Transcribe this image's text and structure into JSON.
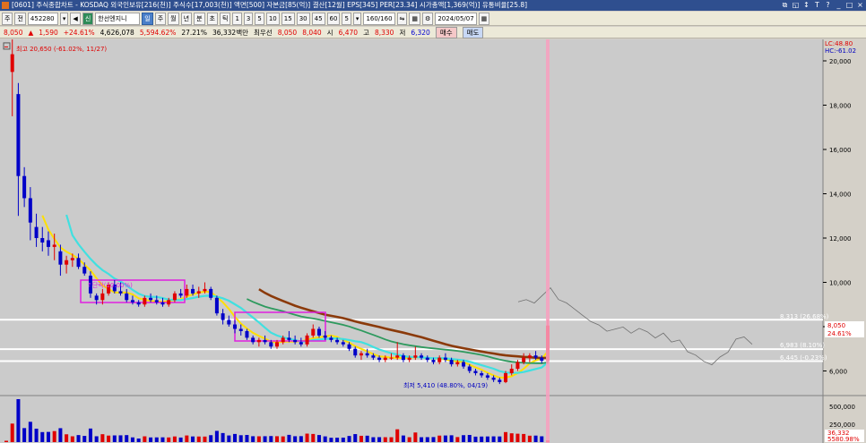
{
  "window": {
    "title": "[0601] 주식종합차트 - KOSDAQ 외국인보유[216(천)] 주식수[17,003(천)] 액면[500] 자본금[85(억)] 결산[12월] EPS[345] PER[23.34] 시가총액[1,369(억)] 유통비율[25.8]",
    "buttons": [
      "⧉",
      "◱",
      "?",
      "↕",
      "T",
      "?",
      "|",
      "_",
      "□",
      "×"
    ]
  },
  "toolbar": {
    "mode": "주",
    "market": "전",
    "code": "452280",
    "stock_name": "한선엔지니",
    "periods": [
      "일",
      "주",
      "월",
      "년",
      "분",
      "초",
      "틱"
    ],
    "active_period": "일",
    "intervals": [
      "1",
      "3",
      "5",
      "10",
      "15",
      "30",
      "45",
      "60"
    ],
    "interval_select": "5",
    "count": "160/160",
    "date": "2024/05/07"
  },
  "quote": {
    "price": "8,050",
    "change_arrow": "▲",
    "change": "1,590",
    "change_pct": "+24.61%",
    "volume": "4,626,078",
    "vol_pct": "5,594.62%",
    "turnover": "27.21%",
    "amount": "36,332백만",
    "priority_label": "최우선",
    "ask": "8,050",
    "bid": "8,040",
    "open_label": "시",
    "open": "6,470",
    "high_label": "고",
    "high": "8,330",
    "low_label": "저",
    "low": "6,320",
    "buy_btn": "매수",
    "sell_btn": "매도"
  },
  "chart_data": {
    "type": "candlestick",
    "price_axis": {
      "ticks": [
        20000,
        18000,
        16000,
        14000,
        12000,
        10000,
        8000,
        6000
      ],
      "tick_labels": [
        "20,000",
        "18,000",
        "16,000",
        "14,000",
        "12,000",
        "10,000",
        "8,000",
        "6,000"
      ],
      "range": [
        4900,
        21500
      ]
    },
    "volume_axis": {
      "tick_labels": [
        "500,000",
        "250,000"
      ]
    },
    "top_right_labels": {
      "lc": "LC:48.80",
      "hc": "HC:-61.02"
    },
    "current_price_label": "8,050",
    "current_change_label": "24.61%",
    "volume_labels": {
      "value": "36,332",
      "pct": "5580.98%"
    },
    "annotations": {
      "high": "최고 20,650 (-61.02%, 11/27)",
      "low": "최저 5,410 (48.80%, 04/19)",
      "box_label": "↑단락(10.00%)"
    },
    "levels": [
      {
        "value": 8313,
        "label": "8,313 (26.68%)"
      },
      {
        "value": 6983,
        "label": "6,983 (8.10%)"
      },
      {
        "value": 6445,
        "label": "6,445 (-0.23%)"
      }
    ],
    "candles": [
      [
        20650,
        20650,
        20650,
        20650
      ],
      [
        19500,
        21000,
        17500,
        20300
      ],
      [
        18500,
        19000,
        13000,
        14800
      ],
      [
        14800,
        15200,
        13400,
        13800
      ],
      [
        13800,
        14300,
        11900,
        12700
      ],
      [
        12500,
        13100,
        11600,
        12000
      ],
      [
        12000,
        12500,
        11400,
        11800
      ],
      [
        11900,
        12300,
        11200,
        11600
      ],
      [
        11600,
        12200,
        11000,
        11700
      ],
      [
        11400,
        11700,
        10300,
        10800
      ],
      [
        10800,
        11200,
        10400,
        11000
      ],
      [
        11000,
        11300,
        10700,
        11100
      ],
      [
        11100,
        11300,
        10600,
        10700
      ],
      [
        10700,
        10900,
        10300,
        10400
      ],
      [
        10300,
        10500,
        9300,
        9500
      ],
      [
        9400,
        9500,
        9000,
        9200
      ],
      [
        9200,
        9700,
        9000,
        9500
      ],
      [
        9500,
        10000,
        9400,
        9900
      ],
      [
        9900,
        10100,
        9500,
        9600
      ],
      [
        9600,
        10000,
        9400,
        9500
      ],
      [
        9500,
        9700,
        9100,
        9200
      ],
      [
        9200,
        9400,
        9000,
        9100
      ],
      [
        9100,
        9200,
        8900,
        9000
      ],
      [
        9000,
        9400,
        8900,
        9300
      ],
      [
        9300,
        9500,
        9100,
        9200
      ],
      [
        9200,
        9400,
        9000,
        9100
      ],
      [
        9100,
        9300,
        8900,
        9000
      ],
      [
        9000,
        9300,
        8900,
        9200
      ],
      [
        9200,
        9600,
        9100,
        9500
      ],
      [
        9500,
        9700,
        9300,
        9400
      ],
      [
        9400,
        9900,
        9300,
        9700
      ],
      [
        9700,
        9900,
        9400,
        9500
      ],
      [
        9500,
        9800,
        9300,
        9600
      ],
      [
        9600,
        10000,
        9500,
        9700
      ],
      [
        9700,
        9800,
        9200,
        9300
      ],
      [
        9300,
        9400,
        8500,
        8600
      ],
      [
        8600,
        8800,
        8100,
        8300
      ],
      [
        8300,
        8500,
        8000,
        8100
      ],
      [
        8100,
        8300,
        7700,
        7900
      ],
      [
        7900,
        8100,
        7600,
        7800
      ],
      [
        7800,
        7900,
        7400,
        7500
      ],
      [
        7500,
        7600,
        7200,
        7300
      ],
      [
        7300,
        7500,
        7100,
        7400
      ],
      [
        7400,
        7600,
        7200,
        7300
      ],
      [
        7300,
        7400,
        7000,
        7100
      ],
      [
        7100,
        7400,
        7000,
        7300
      ],
      [
        7300,
        7600,
        7200,
        7500
      ],
      [
        7500,
        7800,
        7300,
        7400
      ],
      [
        7400,
        7600,
        7200,
        7300
      ],
      [
        7300,
        7500,
        7100,
        7200
      ],
      [
        7200,
        7700,
        7100,
        7600
      ],
      [
        7600,
        8100,
        7500,
        7900
      ],
      [
        7900,
        8000,
        7500,
        7600
      ],
      [
        7600,
        7800,
        7400,
        7500
      ],
      [
        7500,
        7600,
        7300,
        7400
      ],
      [
        7400,
        7500,
        7200,
        7300
      ],
      [
        7300,
        7400,
        7100,
        7200
      ],
      [
        7200,
        7300,
        6900,
        7000
      ],
      [
        7000,
        7100,
        6600,
        6700
      ],
      [
        6700,
        6900,
        6500,
        6800
      ],
      [
        6800,
        7000,
        6600,
        6700
      ],
      [
        6700,
        6800,
        6500,
        6600
      ],
      [
        6600,
        6700,
        6400,
        6500
      ],
      [
        6500,
        6700,
        6400,
        6600
      ],
      [
        6600,
        6800,
        6500,
        6600
      ],
      [
        6600,
        7300,
        6500,
        6700
      ],
      [
        6700,
        6800,
        6400,
        6500
      ],
      [
        6500,
        6700,
        6400,
        6600
      ],
      [
        6600,
        7100,
        6500,
        6700
      ],
      [
        6700,
        6800,
        6500,
        6600
      ],
      [
        6600,
        6700,
        6400,
        6500
      ],
      [
        6500,
        6600,
        6300,
        6400
      ],
      [
        6400,
        6700,
        6300,
        6600
      ],
      [
        6600,
        6800,
        6400,
        6500
      ],
      [
        6500,
        6600,
        6200,
        6300
      ],
      [
        6300,
        6500,
        6200,
        6400
      ],
      [
        6400,
        6500,
        6100,
        6200
      ],
      [
        6200,
        6300,
        5900,
        6000
      ],
      [
        6000,
        6100,
        5800,
        5900
      ],
      [
        5900,
        6000,
        5700,
        5800
      ],
      [
        5800,
        5900,
        5600,
        5700
      ],
      [
        5700,
        5800,
        5500,
        5600
      ],
      [
        5600,
        5700,
        5410,
        5500
      ],
      [
        5500,
        6000,
        5450,
        5900
      ],
      [
        5900,
        6300,
        5800,
        6100
      ],
      [
        6100,
        6500,
        6000,
        6400
      ],
      [
        6400,
        6800,
        6300,
        6600
      ],
      [
        6600,
        6800,
        6400,
        6700
      ],
      [
        6700,
        6900,
        6500,
        6600
      ],
      [
        6600,
        6700,
        6350,
        6460
      ],
      [
        6470,
        8330,
        6320,
        8050
      ]
    ],
    "ma5": [
      [
        12900,
        13000
      ],
      [
        12400,
        12500
      ],
      [
        11900,
        12000
      ],
      [
        11600,
        11700
      ],
      [
        11300,
        11400
      ],
      [
        11100,
        11200
      ],
      [
        10800,
        10900
      ],
      [
        10500,
        10600
      ],
      [
        10100,
        10200
      ],
      [
        9700,
        9800
      ],
      [
        9400,
        9500
      ],
      [
        9300,
        9400
      ],
      [
        9300,
        9300
      ],
      [
        9300,
        9200
      ],
      [
        9200,
        9100
      ],
      [
        9200,
        9000
      ],
      [
        9200,
        9200
      ],
      [
        9300,
        9400
      ],
      [
        9300,
        9500
      ],
      [
        9400,
        9600
      ],
      [
        9200,
        9400
      ],
      [
        8800,
        9000
      ],
      [
        8400,
        8500
      ],
      [
        8100,
        8200
      ],
      [
        7800,
        7900
      ],
      [
        7600,
        7700
      ],
      [
        7400,
        7500
      ],
      [
        7300,
        7300
      ],
      [
        7300,
        7300
      ],
      [
        7400,
        7400
      ],
      [
        7600,
        7500
      ],
      [
        7600,
        7600
      ],
      [
        7500,
        7500
      ],
      [
        7400,
        7300
      ],
      [
        7200,
        7100
      ],
      [
        6900,
        6800
      ],
      [
        6700,
        6600
      ],
      [
        6600,
        6600
      ],
      [
        6600,
        6600
      ],
      [
        6600,
        6600
      ],
      [
        6600,
        6600
      ],
      [
        6500,
        6500
      ],
      [
        6400,
        6300
      ],
      [
        6200,
        6100
      ],
      [
        5900,
        5800
      ],
      [
        5700,
        5600
      ],
      [
        5600,
        5600
      ],
      [
        5800,
        5800
      ],
      [
        6200,
        6100
      ],
      [
        6500,
        6400
      ],
      [
        6600,
        6600
      ]
    ]
  }
}
